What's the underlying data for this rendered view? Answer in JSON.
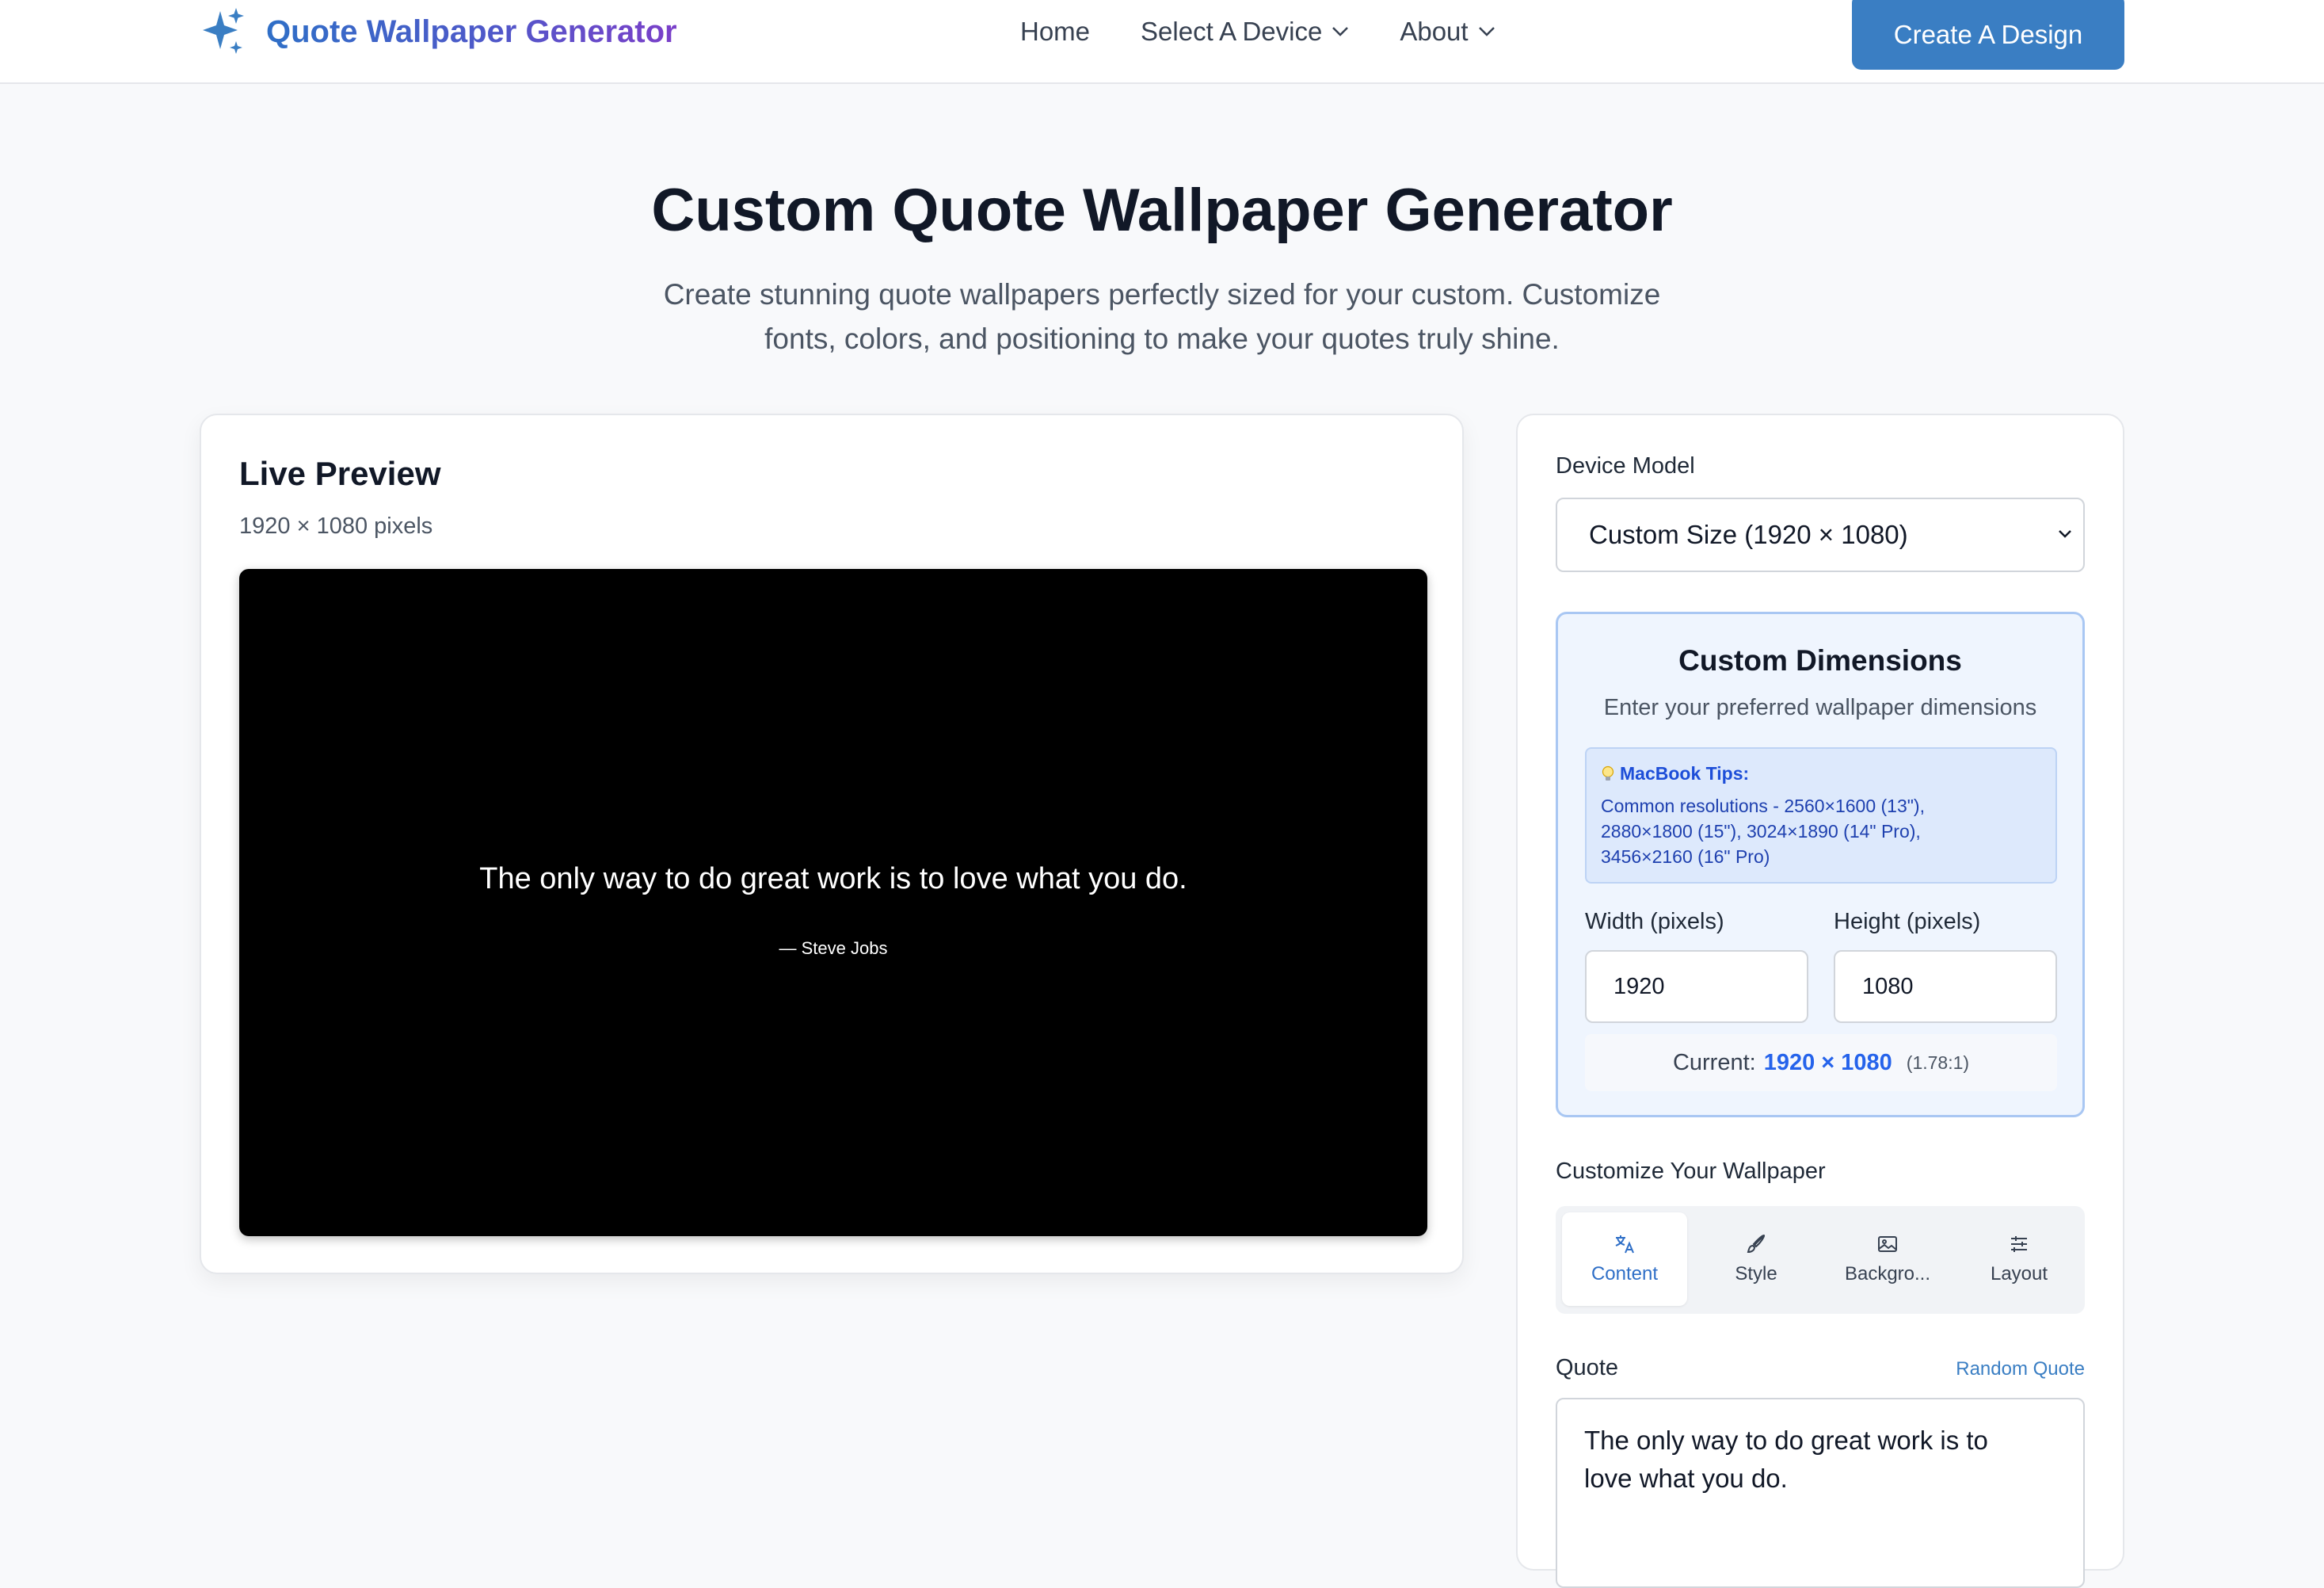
{
  "header": {
    "brand": "Quote Wallpaper Generator",
    "nav": {
      "home": "Home",
      "select_device": "Select A Device",
      "about": "About"
    },
    "cta": "Create A Design"
  },
  "hero": {
    "title": "Custom Quote Wallpaper Generator",
    "subtitle_line1": "Create stunning quote wallpapers perfectly sized for your custom. Customize",
    "subtitle_line2": "fonts, colors, and positioning to make your quotes truly shine."
  },
  "preview": {
    "title": "Live Preview",
    "size": "1920 × 1080 pixels",
    "quote": "The only way to do great work is to love what you do.",
    "author": "— Steve Jobs",
    "background_color": "#000000",
    "text_color": "#ffffff"
  },
  "panel": {
    "device_label": "Device Model",
    "device_selected": "Custom Size (1920 × 1080)",
    "dims": {
      "title": "Custom Dimensions",
      "subtitle": "Enter your preferred wallpaper dimensions",
      "tips_title": "MacBook Tips:",
      "tips_line1": "Common resolutions - 2560×1600 (13\"),",
      "tips_line2": "2880×1800 (15\"), 3024×1890 (14\" Pro),",
      "tips_line3": "3456×2160 (16\" Pro)",
      "width_label": "Width (pixels)",
      "height_label": "Height (pixels)",
      "width_value": "1920",
      "height_value": "1080",
      "current_label": "Current:",
      "current_value": "1920 × 1080",
      "current_ratio": "(1.78:1)"
    },
    "customize_label": "Customize Your Wallpaper",
    "tabs": [
      {
        "label": "Content",
        "icon": "translate-icon",
        "active": true
      },
      {
        "label": "Style",
        "icon": "brush-icon",
        "active": false
      },
      {
        "label": "Backgro...",
        "icon": "image-icon",
        "active": false
      },
      {
        "label": "Layout",
        "icon": "sliders-icon",
        "active": false
      }
    ],
    "quote_label": "Quote",
    "random_quote": "Random Quote",
    "quote_line1": "The only way to do great work is to",
    "quote_line2": "love what you do."
  },
  "colors": {
    "accent": "#3a7ec3",
    "brand_gradient_start": "#2f6fc7",
    "brand_gradient_end": "#7b3fc9",
    "highlight": "#2563eb"
  }
}
